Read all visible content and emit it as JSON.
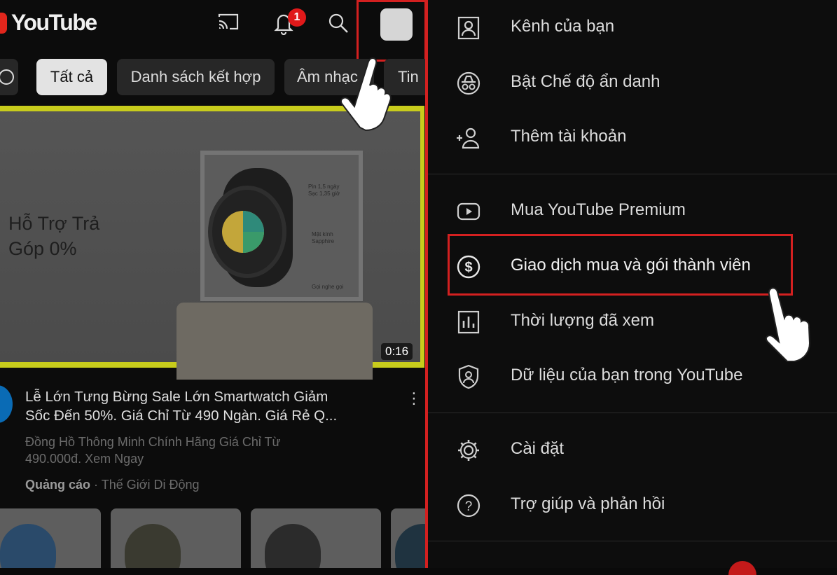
{
  "header": {
    "logo_text": "YouTube",
    "notification_count": "1",
    "icons": [
      "cast-icon",
      "bell-icon",
      "search-icon",
      "avatar"
    ]
  },
  "chips": [
    "Tất cả",
    "Danh sách kết hợp",
    "Âm nhạc",
    "Tin"
  ],
  "ad": {
    "promo_line1": "Hỗ Trợ Trả",
    "promo_line2": "Góp 0%",
    "duration": "0:16",
    "spec1": "Pin 1,5 ngày Sạc 1,35 giờ",
    "spec2": "Mặt kính Sapphire",
    "spec3": "Gọi nghe gọi"
  },
  "video": {
    "title_line1": "Lễ Lớn Tưng Bừng Sale Lớn Smartwatch Giảm",
    "title_line2": "Sốc Đến 50%. Giá Chỉ Từ 490 Ngàn. Giá Rẻ Q...",
    "desc_line1": "Đồng Hồ Thông Minh Chính Hãng Giá Chỉ Từ",
    "desc_line2": "490.000đ. Xem Ngay",
    "ad_label": "Quảng cáo",
    "separator": "·",
    "channel": "Thế Giới Di Động"
  },
  "menu": {
    "items": [
      {
        "label": "Kênh của bạn",
        "icon": "person-box-icon"
      },
      {
        "label": "Bật Chế độ ẩn danh",
        "icon": "incognito-icon"
      },
      {
        "label": "Thêm tài khoản",
        "icon": "add-account-icon"
      },
      {
        "label": "Mua YouTube Premium",
        "icon": "youtube-play-icon"
      },
      {
        "label": "Giao dịch mua và gói thành viên",
        "icon": "dollar-icon"
      },
      {
        "label": "Thời lượng đã xem",
        "icon": "bar-chart-icon"
      },
      {
        "label": "Dữ liệu của bạn trong YouTube",
        "icon": "shield-person-icon"
      },
      {
        "label": "Cài đặt",
        "icon": "gear-icon"
      },
      {
        "label": "Trợ giúp và phản hồi",
        "icon": "help-icon"
      }
    ]
  },
  "colors": {
    "highlight": "#d32020",
    "brand_red": "#e1261c",
    "banner_border": "#c8cc1c"
  }
}
